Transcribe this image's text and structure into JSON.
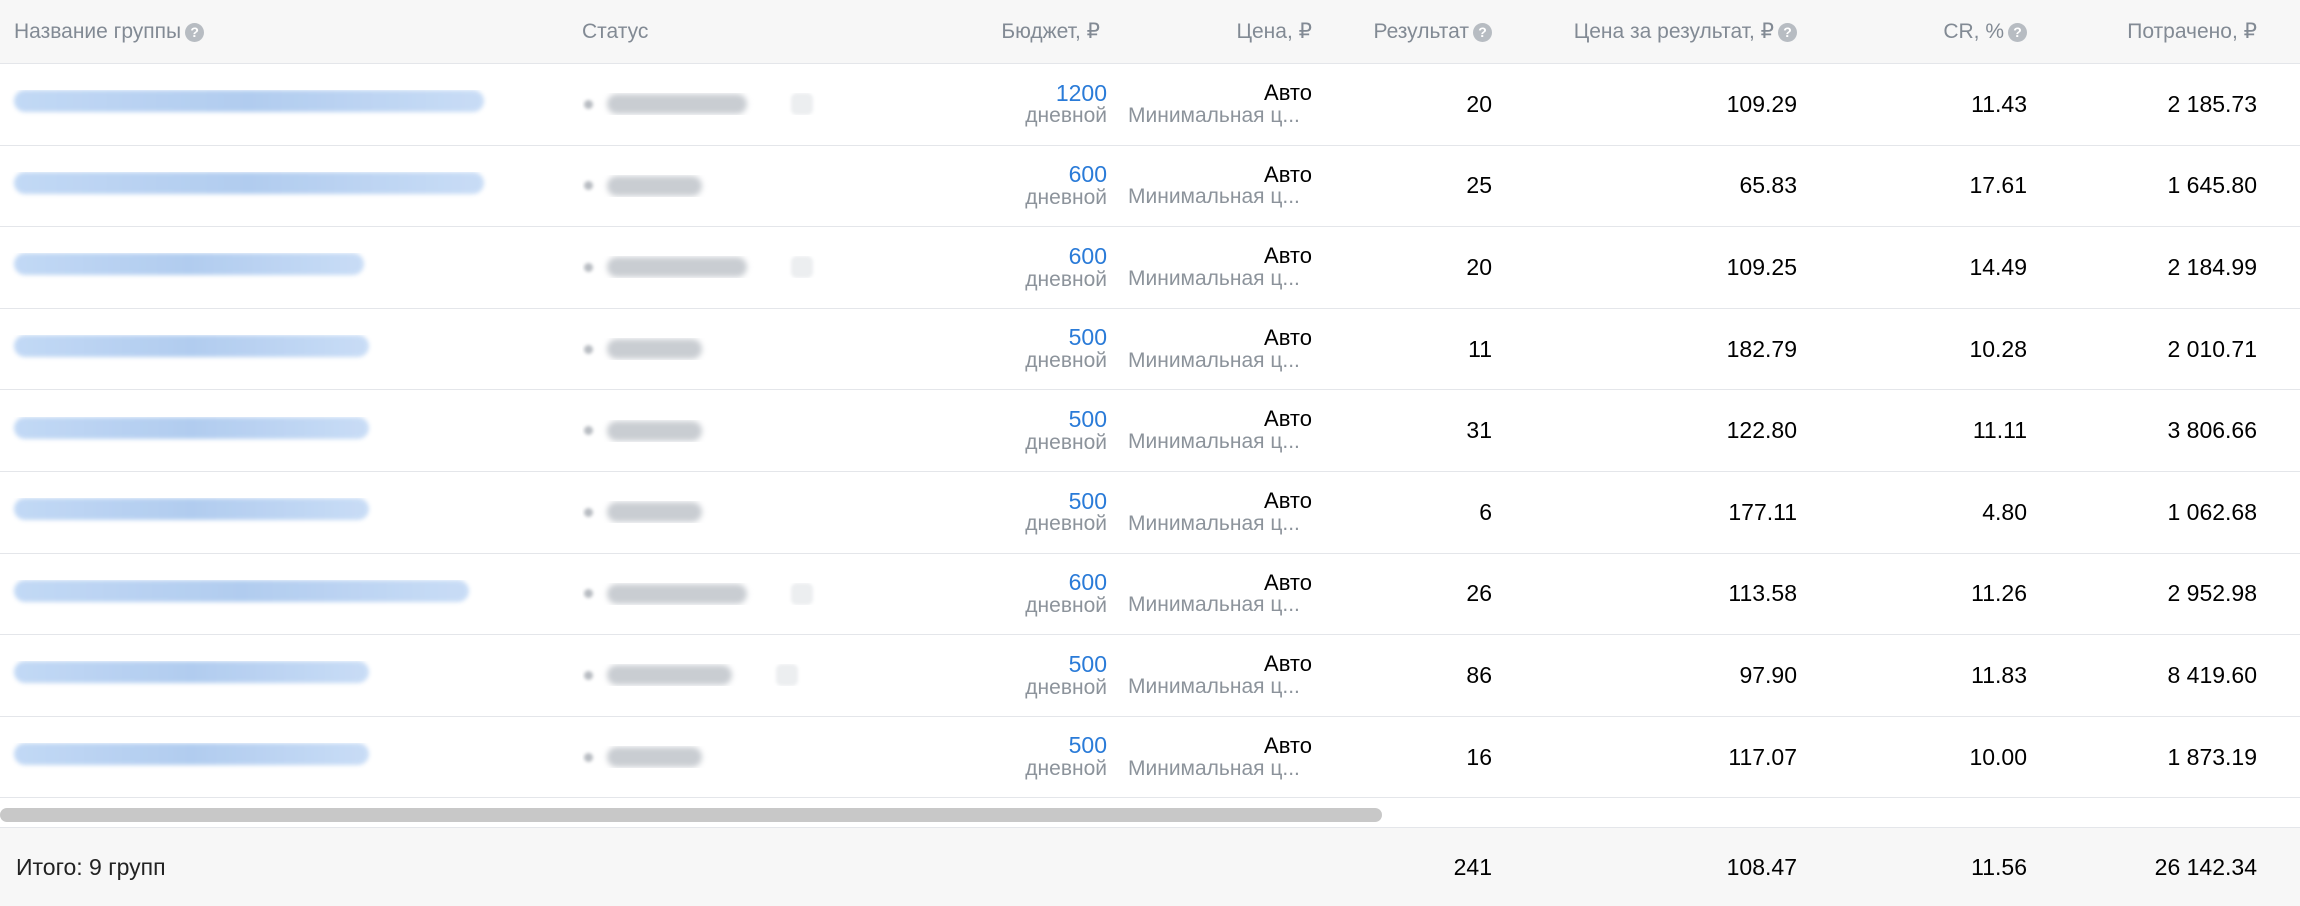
{
  "header": {
    "name": "Название группы",
    "status": "Статус",
    "budget": "Бюджет, ₽",
    "price": "Цена, ₽",
    "result": "Результат",
    "cost_per_result": "Цена за результат, ₽",
    "cr": "CR, %",
    "spent": "Потрачено, ₽",
    "help_glyph": "?"
  },
  "rows": [
    {
      "budget": "1200",
      "budget_period": "дневной",
      "price_mode": "Авто",
      "price_strategy": "Минимальная ц...",
      "result": "20",
      "cost_per_result": "109.29",
      "cr": "11.43",
      "spent": "2 185.73"
    },
    {
      "budget": "600",
      "budget_period": "дневной",
      "price_mode": "Авто",
      "price_strategy": "Минимальная ц...",
      "result": "25",
      "cost_per_result": "65.83",
      "cr": "17.61",
      "spent": "1 645.80"
    },
    {
      "budget": "600",
      "budget_period": "дневной",
      "price_mode": "Авто",
      "price_strategy": "Минимальная ц...",
      "result": "20",
      "cost_per_result": "109.25",
      "cr": "14.49",
      "spent": "2 184.99"
    },
    {
      "budget": "500",
      "budget_period": "дневной",
      "price_mode": "Авто",
      "price_strategy": "Минимальная ц...",
      "result": "11",
      "cost_per_result": "182.79",
      "cr": "10.28",
      "spent": "2 010.71"
    },
    {
      "budget": "500",
      "budget_period": "дневной",
      "price_mode": "Авто",
      "price_strategy": "Минимальная ц...",
      "result": "31",
      "cost_per_result": "122.80",
      "cr": "11.11",
      "spent": "3 806.66"
    },
    {
      "budget": "500",
      "budget_period": "дневной",
      "price_mode": "Авто",
      "price_strategy": "Минимальная ц...",
      "result": "6",
      "cost_per_result": "177.11",
      "cr": "4.80",
      "spent": "1 062.68"
    },
    {
      "budget": "600",
      "budget_period": "дневной",
      "price_mode": "Авто",
      "price_strategy": "Минимальная ц...",
      "result": "26",
      "cost_per_result": "113.58",
      "cr": "11.26",
      "spent": "2 952.98"
    },
    {
      "budget": "500",
      "budget_period": "дневной",
      "price_mode": "Авто",
      "price_strategy": "Минимальная ц...",
      "result": "86",
      "cost_per_result": "97.90",
      "cr": "11.83",
      "spent": "8 419.60"
    },
    {
      "budget": "500",
      "budget_period": "дневной",
      "price_mode": "Авто",
      "price_strategy": "Минимальная ц...",
      "result": "16",
      "cost_per_result": "117.07",
      "cr": "10.00",
      "spent": "1 873.19"
    }
  ],
  "footer": {
    "label": "Итого: 9 групп",
    "result": "241",
    "cost_per_result": "108.47",
    "cr": "11.56",
    "spent": "26 142.34"
  },
  "colors": {
    "link": "#2a7bd8",
    "muted": "#8c939b",
    "header_bg": "#f7f7f7"
  }
}
